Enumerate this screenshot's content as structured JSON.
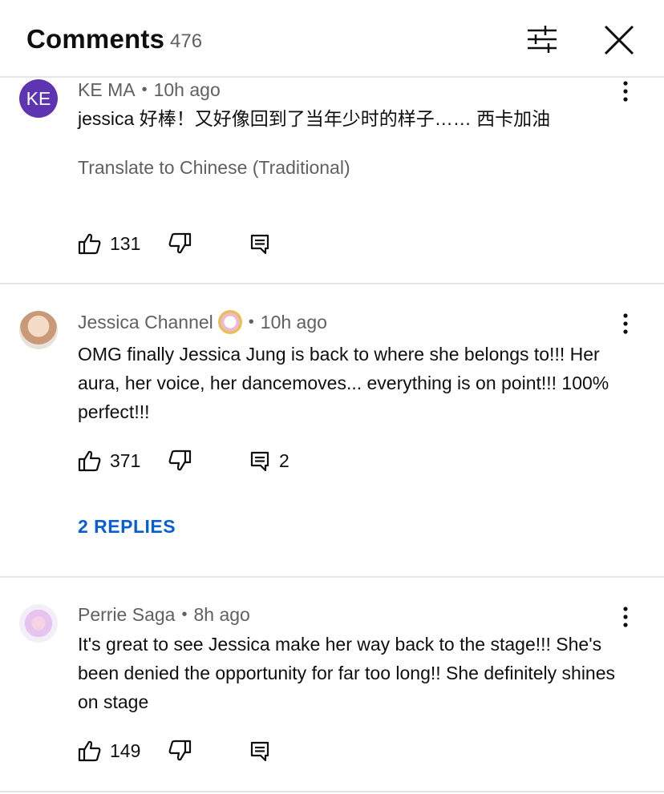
{
  "header": {
    "title": "Comments",
    "count": "476",
    "filter_icon": "sliders-icon",
    "close_icon": "close-icon"
  },
  "comments": [
    {
      "avatar_text": "KE",
      "avatar_color": "#5e35b1",
      "author": "KE MA",
      "time": "10h ago",
      "text": "jessica 好棒！又好像回到了当年少时的样子…… 西卡加油",
      "translate": "Translate to Chinese (Traditional)",
      "likes": "131",
      "replies_count": ""
    },
    {
      "avatar_text": "",
      "author": "Jessica Channel",
      "time": "10h ago",
      "text": "OMG finally Jessica Jung is back to where she belongs to!!! Her aura, her voice, her dancemoves... everything is on point!!! 100% perfect!!!",
      "likes": "371",
      "replies_count": "2",
      "replies_link": "2 REPLIES"
    },
    {
      "avatar_text": "",
      "author": "Perrie Saga",
      "time": "8h ago",
      "text": "It's great to see Jessica make her way back to the stage!!! She's been denied the opportunity for far too long!! She definitely shines on stage",
      "likes": "149",
      "replies_count": ""
    }
  ],
  "colors": {
    "link_blue": "#065fd4",
    "secondary_text": "#606060",
    "divider": "#e5e5e5"
  }
}
